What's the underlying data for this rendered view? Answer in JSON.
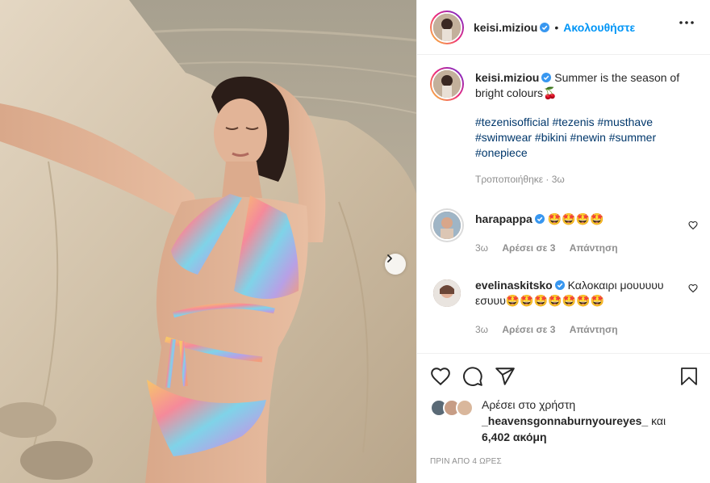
{
  "header": {
    "username": "keisi.miziou",
    "separator": "•",
    "follow_label": "Ακολουθήστε"
  },
  "caption": {
    "username": "keisi.miziou",
    "text": "Summer is the season of bright colours🍒",
    "hashtags": [
      "#tezenisofficial",
      "#tezenis",
      "#musthave",
      "#swimwear",
      "#bikini",
      "#newin",
      "#summer",
      "#onepiece"
    ],
    "edited": "Τροποποιήθηκε · 3ω"
  },
  "comments": [
    {
      "username": "harapappa",
      "text": "🤩🤩🤩🤩",
      "time": "3ω",
      "likes": "Αρέσει σε 3",
      "reply": "Απάντηση"
    },
    {
      "username": "evelinaskitsko",
      "text": "Καλοκαιρι μουυυυυ εσυυυ🤩🤩🤩🤩🤩🤩🤩",
      "time": "3ω",
      "likes": "Αρέσει σε 3",
      "reply": "Απάντηση"
    }
  ],
  "likes": {
    "prefix": "Αρέσει στο χρήστη",
    "user": "_heavensgonnaburnyoureyes_",
    "conj": "και",
    "count": "6,402 ακόμη"
  },
  "timestamp": "ΠΡΙΝ ΑΠΟ 4 ΩΡΕΣ",
  "icons": {
    "more": "more-options-icon",
    "like": "heart-icon",
    "comment": "comment-icon",
    "share": "share-icon",
    "save": "bookmark-icon",
    "next": "chevron-right-icon",
    "verified": "verified-badge-icon"
  },
  "colors": {
    "follow": "#0095f6",
    "hashtag": "#00376b",
    "verified": "#3897f0",
    "meta": "#8e8e8e"
  }
}
